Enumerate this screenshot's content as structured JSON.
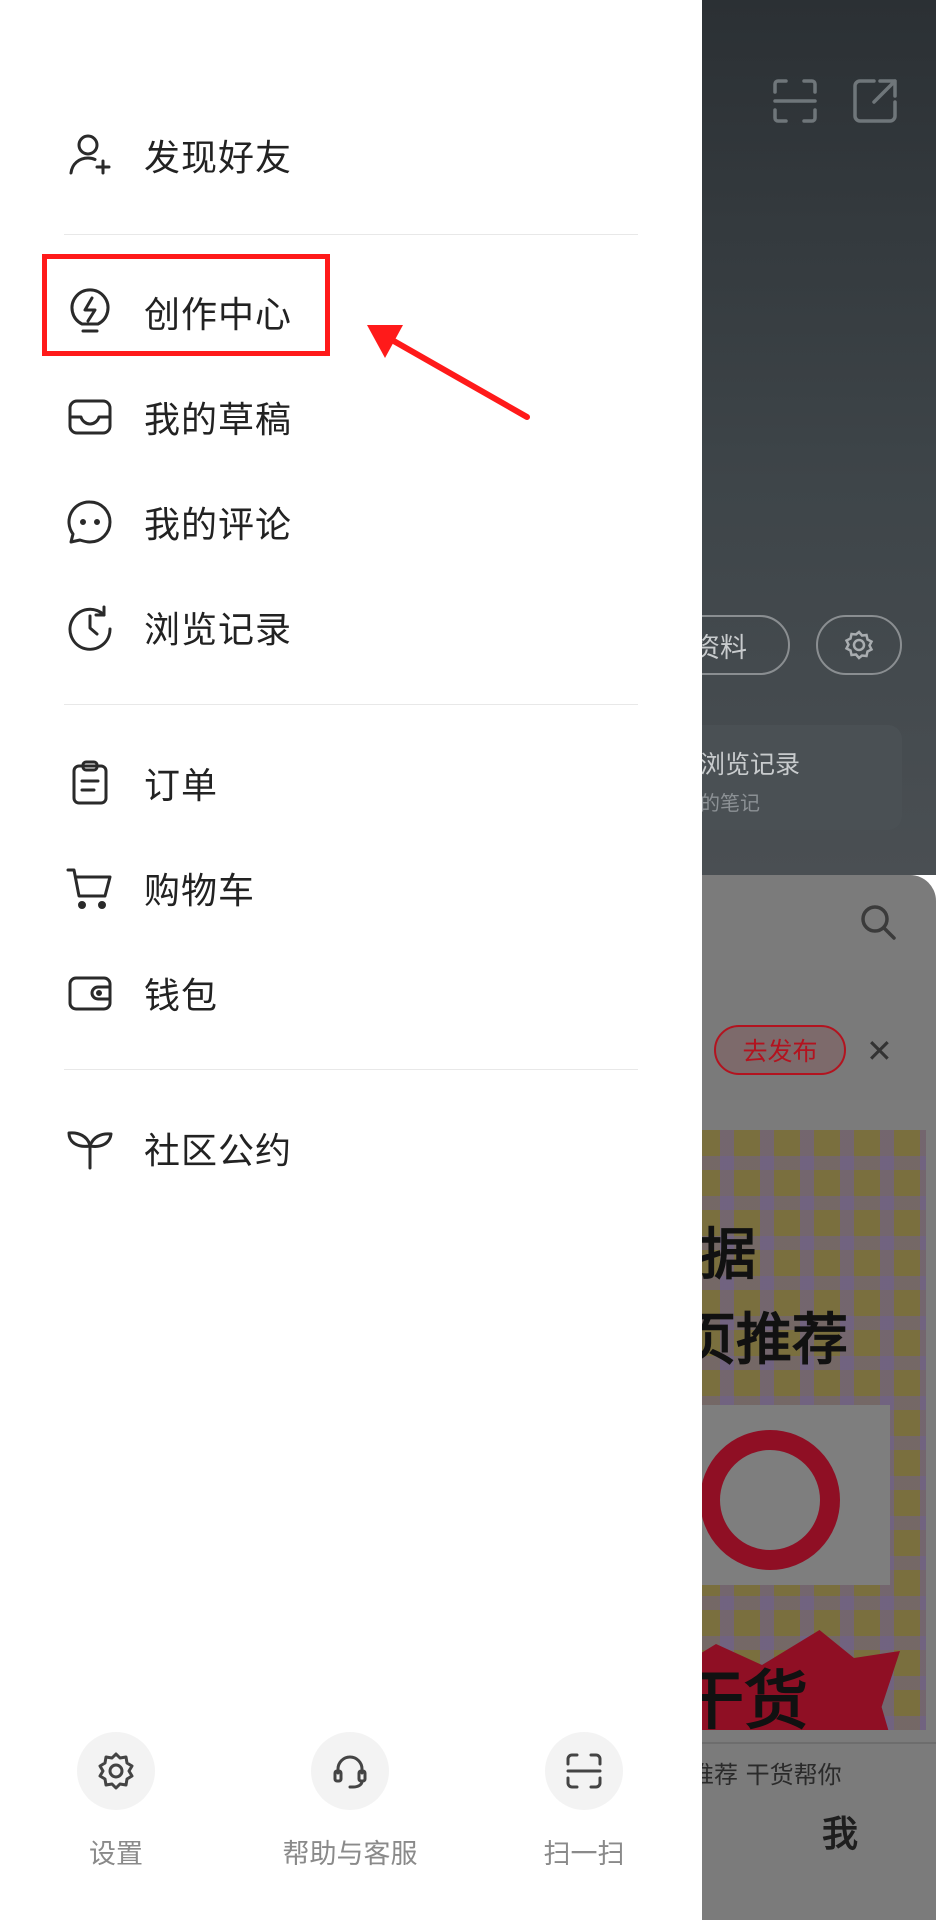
{
  "drawer": {
    "menu_groups": [
      {
        "items": [
          {
            "label": "发现好友",
            "icon": "add-user-icon"
          }
        ]
      },
      {
        "items": [
          {
            "label": "创作中心",
            "icon": "lightning-bulb-icon"
          },
          {
            "label": "我的草稿",
            "icon": "inbox-tray-icon"
          },
          {
            "label": "我的评论",
            "icon": "chat-bubble-icon"
          },
          {
            "label": "浏览记录",
            "icon": "history-clock-icon"
          }
        ]
      },
      {
        "items": [
          {
            "label": "订单",
            "icon": "clipboard-icon"
          },
          {
            "label": "购物车",
            "icon": "shopping-cart-icon"
          },
          {
            "label": "钱包",
            "icon": "wallet-icon"
          }
        ]
      },
      {
        "items": [
          {
            "label": "社区公约",
            "icon": "sprout-icon"
          }
        ]
      }
    ],
    "bottom_actions": [
      {
        "label": "设置",
        "icon": "gear-icon"
      },
      {
        "label": "帮助与客服",
        "icon": "headset-icon"
      },
      {
        "label": "扫一扫",
        "icon": "scan-icon"
      }
    ],
    "annotation": {
      "highlighted_item": "创作中心",
      "color": "#ff1a1a"
    }
  },
  "background": {
    "profile_button": "资料",
    "history_card": {
      "title": "浏览记录",
      "subtitle": "的笔记"
    },
    "publish_button": "去发布",
    "close_glyph": "✕",
    "poster_lines": [
      "据",
      "页推荐",
      "干货"
    ],
    "tabs_text": "推荐   干货帮你",
    "tab_me": "我"
  }
}
